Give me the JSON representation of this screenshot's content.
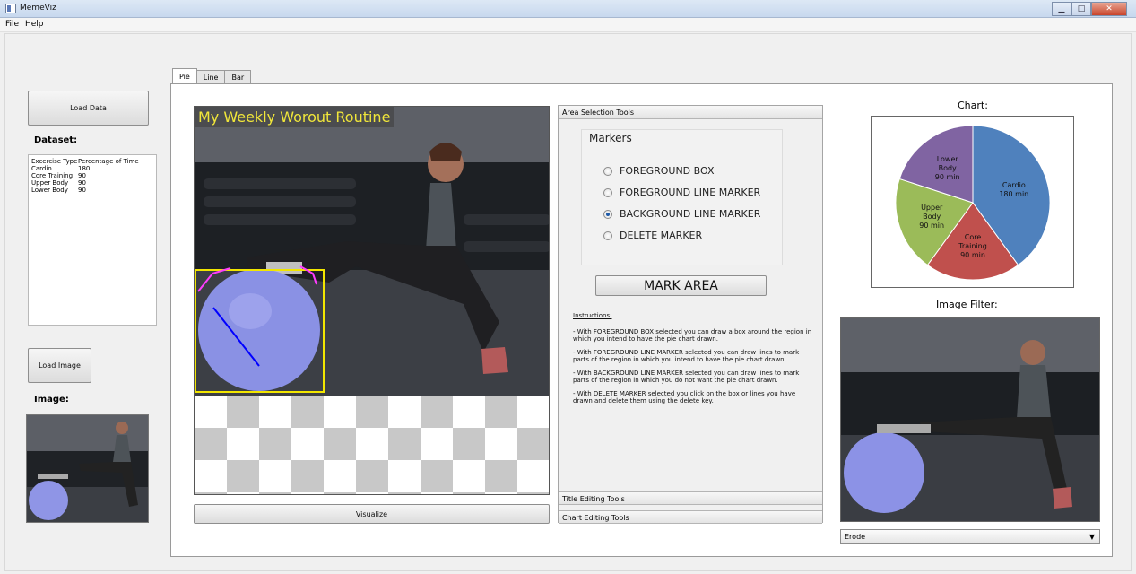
{
  "window": {
    "title": "MemeViz"
  },
  "menu": [
    "File",
    "Help"
  ],
  "left": {
    "load_data": "Load Data",
    "dataset_label": "Dataset:",
    "dataset": {
      "headers": [
        "Excercise Type",
        "Percentage of Time"
      ],
      "rows": [
        [
          "Cardio",
          "180"
        ],
        [
          "Core Training",
          "90"
        ],
        [
          "Upper Body",
          "90"
        ],
        [
          "Lower Body",
          "90"
        ]
      ]
    },
    "load_image": "Load Image",
    "image_label": "Image:"
  },
  "tabs": [
    {
      "label": "Pie",
      "active": true
    },
    {
      "label": "Line"
    },
    {
      "label": "Bar"
    }
  ],
  "canvas": {
    "meme_title": "My Weekly Worout Routine",
    "visualize": "Visualize"
  },
  "tools": {
    "area_header": "Area Selection Tools",
    "markers_title": "Markers",
    "options": [
      "FOREGROUND BOX",
      "FOREGROUND LINE MARKER",
      "BACKGROUND LINE MARKER",
      "DELETE MARKER"
    ],
    "selected": "BACKGROUND LINE MARKER",
    "mark_area": "MARK AREA",
    "instructions_title": "Instructions:",
    "instructions": [
      "- With FOREGROUND BOX selected you can draw a box around the region in which you intend to have the pie chart drawn.",
      "- With FOREGROUND LINE MARKER selected you can draw lines to mark parts of the region in which you intend to have the pie chart drawn.",
      "- With BACKGROUND LINE MARKER selected you can draw lines to mark parts of the region in which you do not want the pie chart drawn.",
      "- With DELETE MARKER selected you click on the box or lines you have drawn and delete them using the delete key."
    ],
    "title_header": "Title Editing Tools",
    "chart_header": "Chart Editing Tools"
  },
  "right": {
    "chart_label": "Chart:",
    "filter_label": "Image Filter:",
    "filter_value": "Erode"
  },
  "chart_data": {
    "type": "pie",
    "categories": [
      "Cardio",
      "Core Training",
      "Upper Body",
      "Lower Body"
    ],
    "values": [
      180,
      90,
      90,
      90
    ],
    "labels": [
      [
        "Cardio",
        "180 min"
      ],
      [
        "Core",
        "Training",
        "90 min"
      ],
      [
        "Upper",
        "Body",
        "90 min"
      ],
      [
        "Lower",
        "Body",
        "90 min"
      ]
    ],
    "colors": [
      "#4f81bd",
      "#c0504d",
      "#9bbb59",
      "#8064a2"
    ]
  }
}
